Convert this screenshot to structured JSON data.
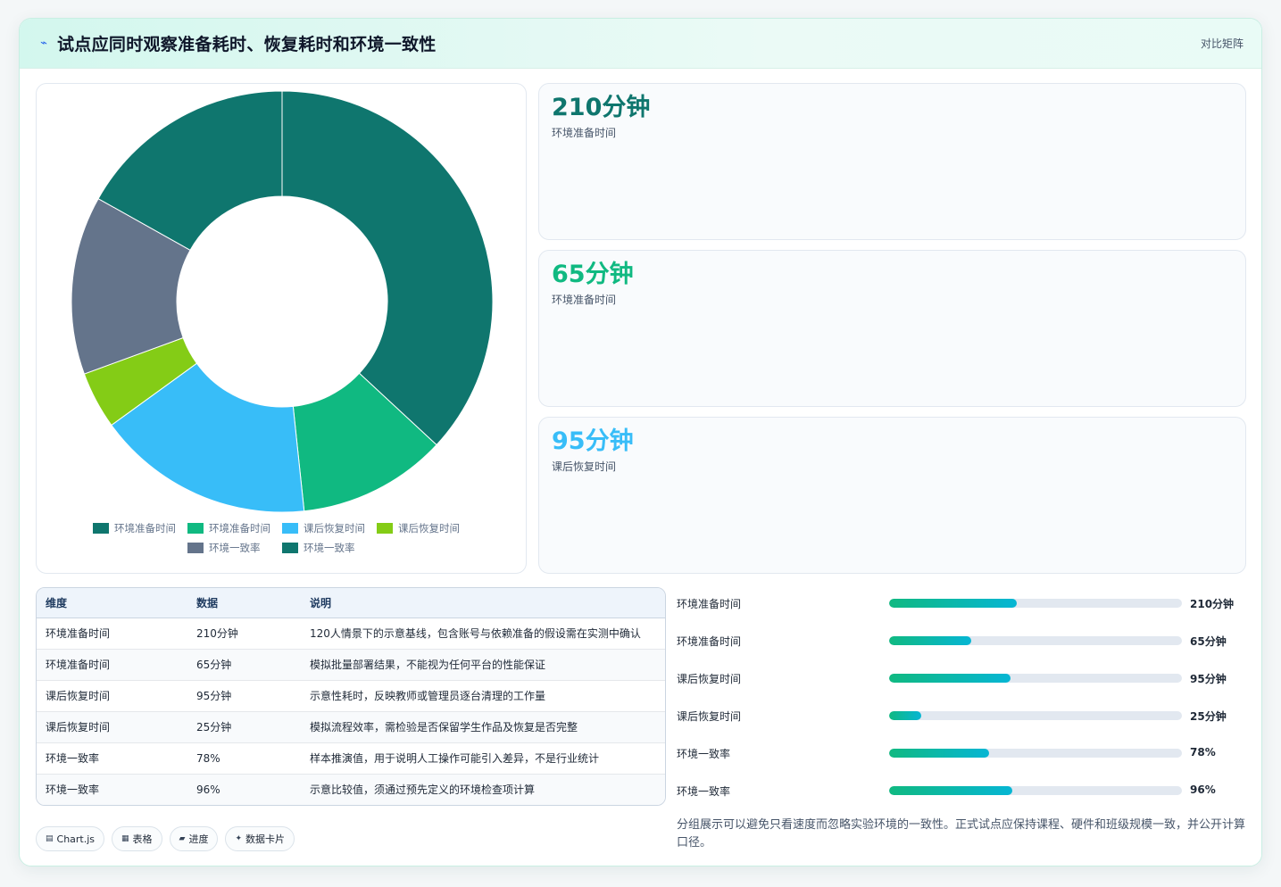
{
  "header": {
    "icon": "sparkline-icon",
    "title": "试点应同时观察准备耗时、恢复耗时和环境一致性",
    "link": "对比矩阵"
  },
  "chart_data": {
    "type": "pie",
    "donut": true,
    "labels": [
      "环境准备时间",
      "环境准备时间",
      "课后恢复时间",
      "课后恢复时间",
      "环境一致率",
      "环境一致率"
    ],
    "values": [
      210,
      65,
      95,
      25,
      78,
      96
    ],
    "colors": [
      "#0f766e",
      "#10b981",
      "#38bdf8",
      "#84cc16",
      "#64748b",
      "#0f766e"
    ],
    "legend_position": "bottom"
  },
  "kpis": [
    {
      "value": "210分钟",
      "label": "环境准备时间",
      "color": "#0f766e"
    },
    {
      "value": "65分钟",
      "label": "环境准备时间",
      "color": "#10b981"
    },
    {
      "value": "95分钟",
      "label": "课后恢复时间",
      "color": "#38bdf8"
    }
  ],
  "table": {
    "headers": [
      "维度",
      "数据",
      "说明"
    ],
    "rows": [
      [
        "环境准备时间",
        "210分钟",
        "120人情景下的示意基线，包含账号与依赖准备的假设需在实测中确认"
      ],
      [
        "环境准备时间",
        "65分钟",
        "模拟批量部署结果，不能视为任何平台的性能保证"
      ],
      [
        "课后恢复时间",
        "95分钟",
        "示意性耗时，反映教师或管理员逐台清理的工作量"
      ],
      [
        "课后恢复时间",
        "25分钟",
        "模拟流程效率，需检验是否保留学生作品及恢复是否完整"
      ],
      [
        "环境一致率",
        "78%",
        "样本推演值，用于说明人工操作可能引入差异，不是行业统计"
      ],
      [
        "环境一致率",
        "96%",
        "示意比较值，须通过预先定义的环境检查项计算"
      ]
    ]
  },
  "pills": [
    {
      "icon": "chart-icon",
      "glyph": "▤",
      "label": "Chart.js"
    },
    {
      "icon": "table-icon",
      "glyph": "▦",
      "label": "表格"
    },
    {
      "icon": "progress-icon",
      "glyph": "▰",
      "label": "进度"
    },
    {
      "icon": "card-icon",
      "glyph": "✦",
      "label": "数据卡片"
    }
  ],
  "progress": [
    {
      "label": "环境准备时间",
      "value": "210分钟",
      "fraction": 0.435
    },
    {
      "label": "环境准备时间",
      "value": "65分钟",
      "fraction": 0.28
    },
    {
      "label": "课后恢复时间",
      "value": "95分钟",
      "fraction": 0.415
    },
    {
      "label": "课后恢复时间",
      "value": "25分钟",
      "fraction": 0.11
    },
    {
      "label": "环境一致率",
      "value": "78%",
      "fraction": 0.34
    },
    {
      "label": "环境一致率",
      "value": "96%",
      "fraction": 0.42
    }
  ],
  "note": "分组展示可以避免只看速度而忽略实验环境的一致性。正式试点应保持课程、硬件和班级规模一致，并公开计算口径。"
}
